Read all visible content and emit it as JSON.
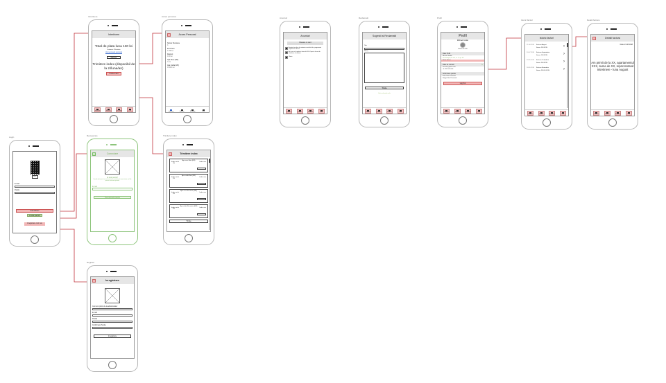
{
  "labels": {
    "intretinere": "Intretinere",
    "acces": "Acces personal",
    "login": "Login",
    "recuperare": "Recuperare",
    "trimitere": "Trimitere index",
    "register": "Register",
    "anunturi": "Anunturi",
    "reclamatii": "Reclamatii",
    "profil": "Profil",
    "istoric": "Istoric facturi",
    "detalii": "Detalii factura"
  },
  "tabs": [
    "Intretinere",
    "Anunturi",
    "Reclamatii",
    "Profil"
  ],
  "intretinere": {
    "title": "Intretinere",
    "total": "Total de plata luna 130 lei",
    "scadenta": "Scadenta: 25/iunie/xx",
    "link": "Vezi accesari personal",
    "pay": "Plateste",
    "index_title": "Trimitere index (disponibil de la zi/luna/an)",
    "index_btn": "Trimite index"
  },
  "acces": {
    "title": "Acces Personal",
    "fields": [
      [
        "Numar Persoane",
        "3"
      ],
      [
        "Intretinere",
        "1.250 lei"
      ],
      [
        "Restant",
        "0.00 lei"
      ],
      [
        "Apa Rece (M3)",
        "7.24"
      ],
      [
        "Apa Calda (M3)",
        "0.0000 lei"
      ]
    ]
  },
  "login": {
    "email": "E-mail",
    "parola": "Parola",
    "ro": "RO",
    "auth": "Autentificare",
    "forgot": "Ai uitat parola?",
    "register": "Inregistrare cont nou"
  },
  "conectare": {
    "title": "Conectare",
    "q": "Ai uitat parola?",
    "desc": "Introdu adresa de e-mail asociata contului si iti vom trimite un link pentru resetarea parolei.",
    "email": "E-mail",
    "btn": "Recupereaza parola"
  },
  "trimitere": {
    "title": "Trimitere index",
    "cards": [
      "Apa rece Baie (M3)",
      "Apa calda Baie (M3)",
      "Apa rece Bucatarie (M3)",
      "Apa calda Bucatarie (M3)"
    ],
    "vechi": "Index vechi",
    "nou": "Index nou",
    "val": "XX",
    "btn": "Trimite"
  },
  "inregistrare": {
    "title": "Inregistrare",
    "fields": [
      "Cod unic primit de la administrator",
      "E-mail",
      "Parola",
      "Confirmare Parola"
    ],
    "btn": "Inregistrare"
  },
  "anunturi": {
    "title": "Anunturi",
    "btn": "Plateste cu card",
    "items": [
      "Anuntul se refera la curatenia scarii de bloc, programata saptamana viitoare",
      "Azi, apa va fi oprita in intervalul 10-14 pentru lucrari de intretinere la coloana",
      "Oferta"
    ]
  },
  "sugestii": {
    "title": "Sugestii si Reclamatii",
    "subject": "Titlu",
    "message": "Mesaj",
    "btn": "Trimite",
    "link": "Vezi reclamatii mele"
  },
  "profil": {
    "title": "Profil",
    "name": "Michael Jordan",
    "sub": "Membru din 2018",
    "date_sec": "Date Profil",
    "person": "Michael Jordan",
    "address": "Str. Exemplu, bl. XX, sc. X, ap. XX",
    "istoric": "Istoric facturi",
    "contact_sec": "Date de contact",
    "email": "michael@jordan.com",
    "phone": "+4 072 XXX XXX",
    "pass_sec": "Schimbare parola",
    "p1": "Enter New Password",
    "p2": "Retype New Password",
    "logout": "Log Out"
  },
  "istoric": {
    "title": "Istoric facturi",
    "rows": [
      [
        "21.08.2018",
        "Factura August",
        "Suma: 230 RON"
      ],
      [
        "20.07.2018",
        "Factura Septembrie",
        "Suma: 150 RON"
      ],
      [
        "19.06.2018",
        "Factura Octombrie",
        "Suma: 200 RON"
      ],
      [
        "18.05.2018",
        "Factura Noiembrie",
        "Suma: 230.50 RON"
      ]
    ]
  },
  "detalii": {
    "title": "Detalii factura",
    "date": "Data: 21.08.2018",
    "text": "Am primit de la XX, apartamentul XXX, suma de XX, reprezentand Intretinere - luna August"
  },
  "colors": {
    "link": "#c0303a",
    "pink": "#f2b6b6",
    "green": "#8cc47a"
  }
}
